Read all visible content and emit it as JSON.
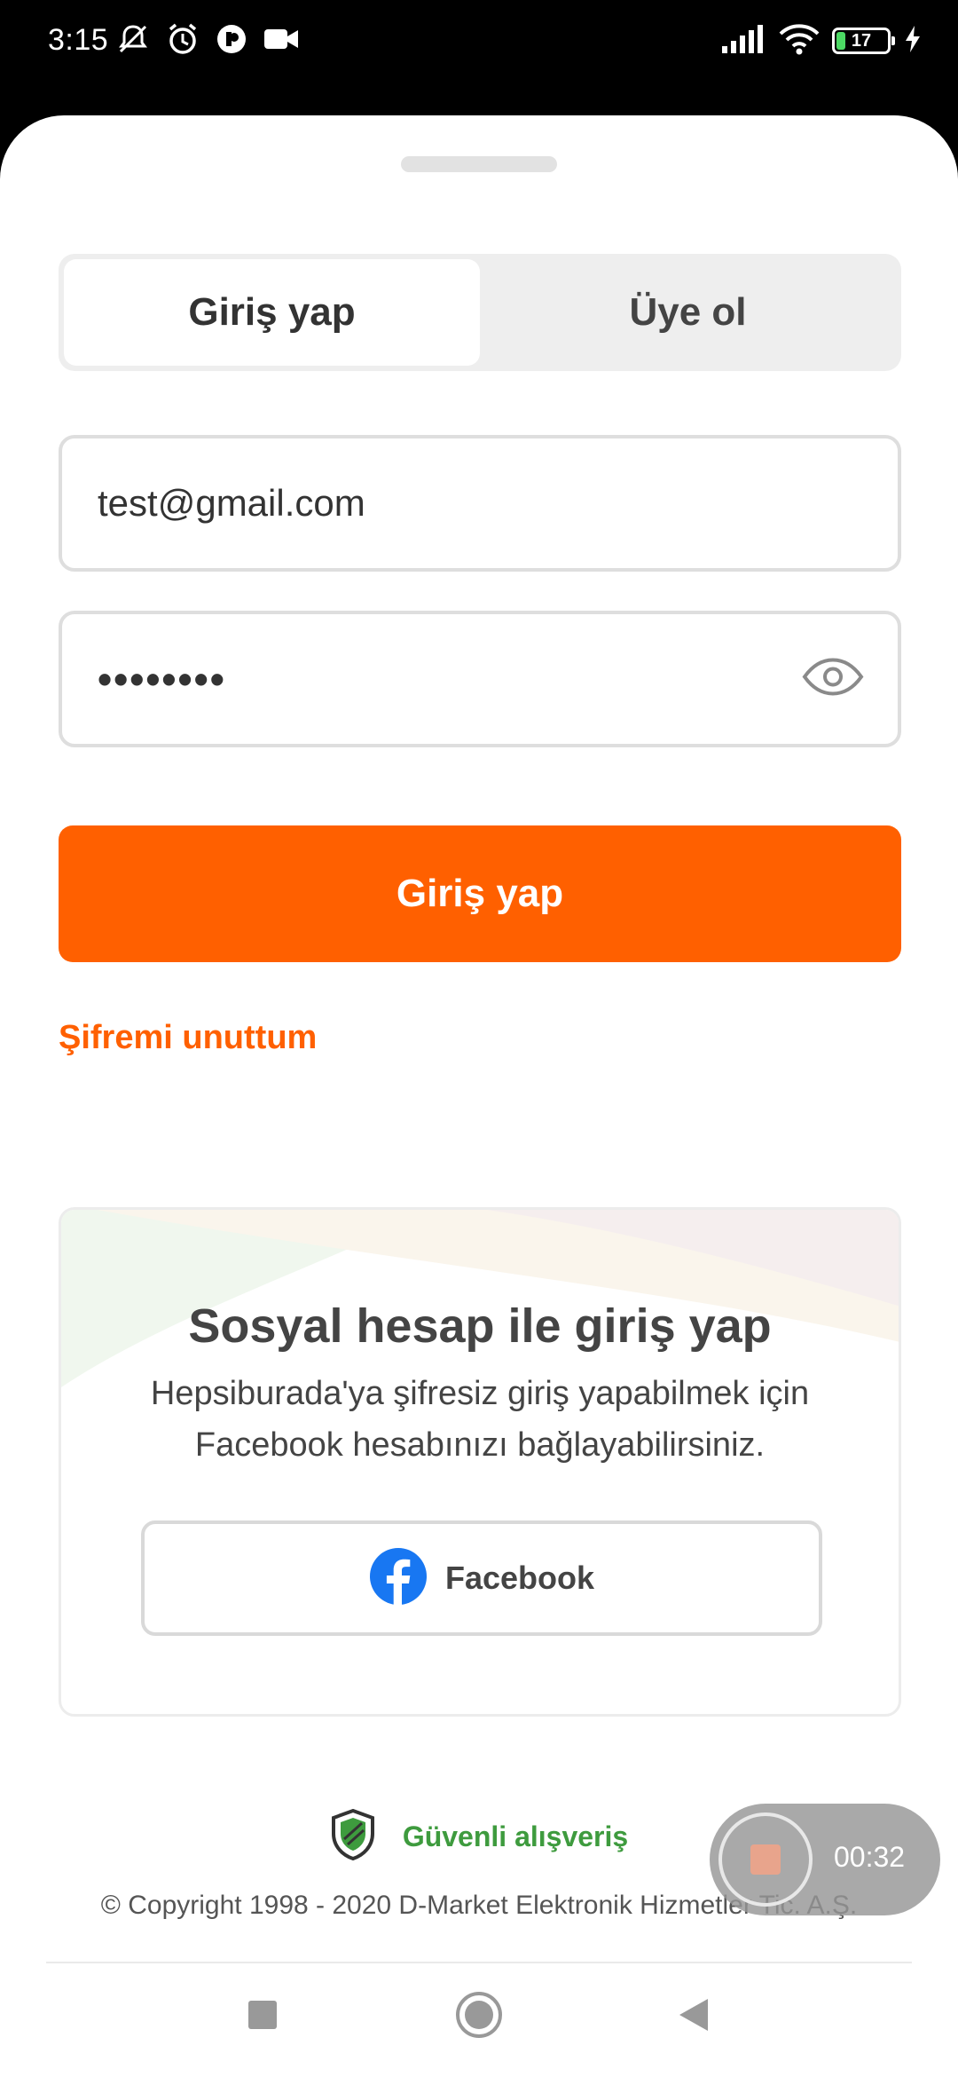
{
  "status_bar": {
    "time": "3:15",
    "battery_level": "17",
    "battery_percent": 17
  },
  "tabs": {
    "login_label": "Giriş yap",
    "register_label": "Üye ol",
    "active": "login"
  },
  "form": {
    "email_value": "test@gmail.com",
    "password_value": "••••••••",
    "submit_label": "Giriş yap",
    "forgot_password_label": "Şifremi unuttum"
  },
  "social": {
    "title": "Sosyal hesap ile giriş yap",
    "description_line1": "Hepsiburada'ya şifresiz giriş yapabilmek için",
    "description_line2": "Facebook hesabınızı bağlayabilirsiniz.",
    "facebook_label": "Facebook"
  },
  "footer": {
    "secure_label": "Güvenli alışveriş",
    "copyright": "© Copyright 1998 - 2020 D-Market Elektronik Hizmetler Tic. A.Ş."
  },
  "recorder": {
    "elapsed": "00:32"
  },
  "colors": {
    "brand_orange": "#ff6000",
    "secure_green": "#3e9b3e",
    "facebook_blue": "#1877f2"
  },
  "icons": {
    "status_left": [
      "mute-icon",
      "alarm-icon",
      "app-icon",
      "video-icon"
    ],
    "status_right": [
      "signal-icon",
      "wifi-icon",
      "battery-icon",
      "charging-icon"
    ],
    "password_toggle": "eye-icon",
    "secure": "shield-icon",
    "nav": [
      "recents-icon",
      "home-icon",
      "back-icon"
    ]
  }
}
